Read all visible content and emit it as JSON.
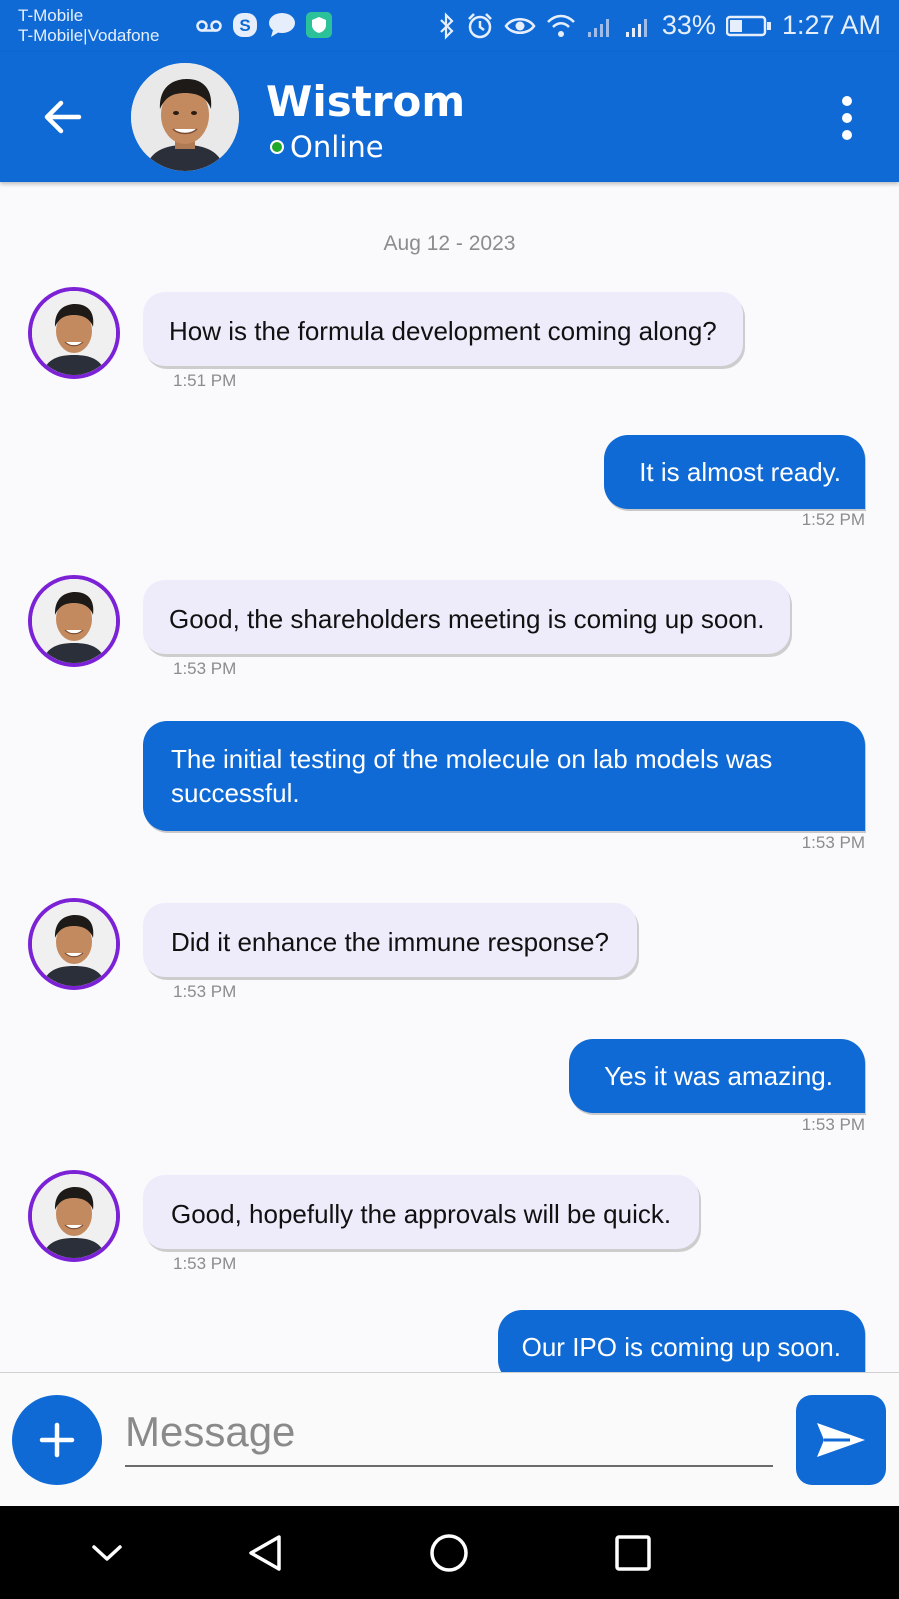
{
  "status_bar": {
    "carrier_1": "T-Mobile",
    "carrier_2": "T-Mobile|Vodafone",
    "battery": "33%",
    "time": "1:27 AM"
  },
  "header": {
    "contact_name": "Wistrom",
    "status": "Online",
    "back_icon": "arrow-left-icon",
    "menu_icon": "more-vert-icon"
  },
  "chat": {
    "date": "Aug 12 - 2023",
    "messages": [
      {
        "dir": "in",
        "text": "How is the formula development coming along?",
        "time": "1:51 PM"
      },
      {
        "dir": "out",
        "text": "It is almost ready.",
        "time": "1:52 PM"
      },
      {
        "dir": "in",
        "text": "Good, the shareholders meeting is coming up soon.",
        "time": "1:53 PM"
      },
      {
        "dir": "out",
        "text": "The initial testing of the molecule on lab models was successful.",
        "time": "1:53 PM"
      },
      {
        "dir": "in",
        "text": "Did it enhance the immune response?",
        "time": "1:53 PM"
      },
      {
        "dir": "out",
        "text": "Yes it was amazing.",
        "time": "1:53 PM"
      },
      {
        "dir": "in",
        "text": "Good, hopefully the approvals will be quick.",
        "time": "1:53 PM"
      },
      {
        "dir": "out",
        "text": "Our IPO is coming up soon.",
        "time": ""
      }
    ]
  },
  "composer": {
    "placeholder": "Message",
    "value": ""
  },
  "colors": {
    "primary": "#0f6ad6",
    "incoming_bubble": "#eeecfb",
    "avatar_ring": "#7b22d6",
    "online": "#1fa82a"
  }
}
